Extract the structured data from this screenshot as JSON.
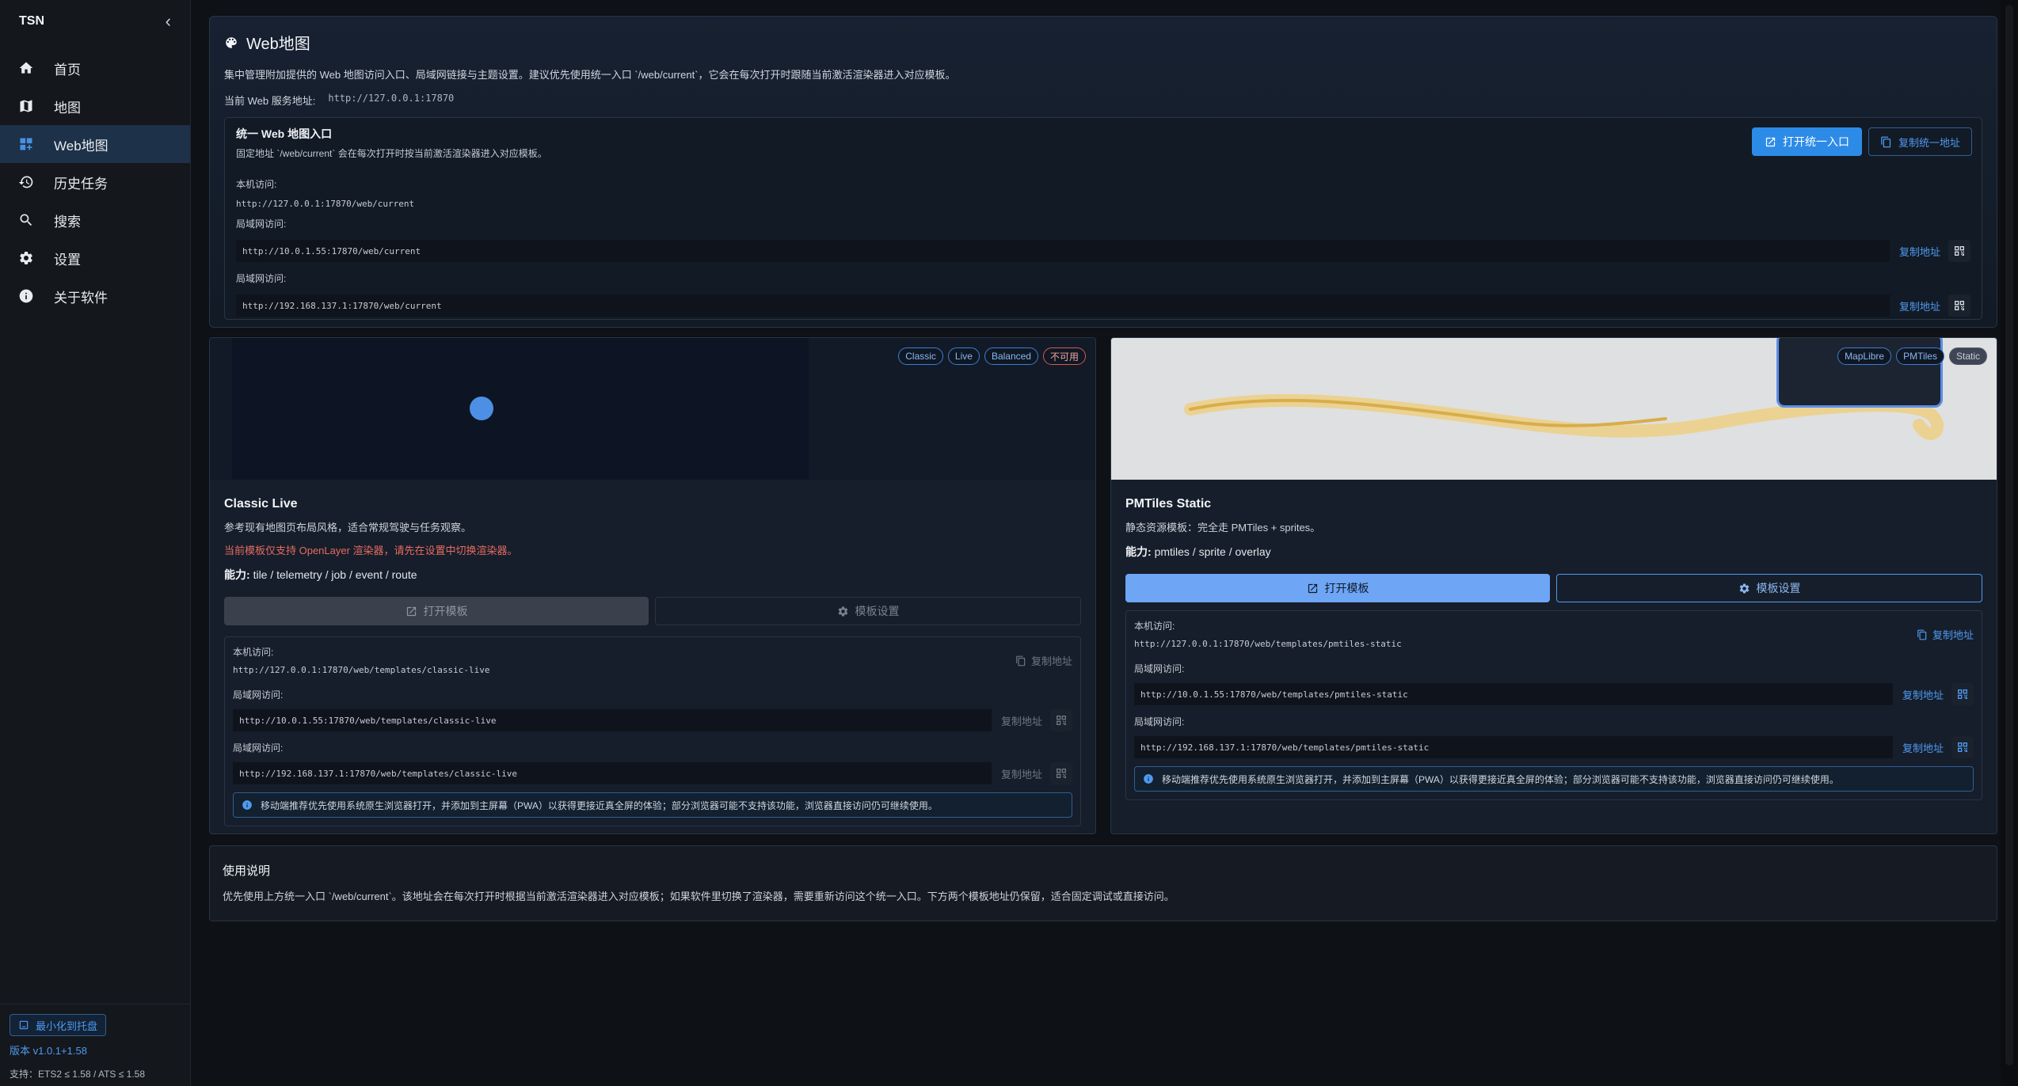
{
  "sidebar": {
    "brand": "TSN",
    "collapse_icon": "chevron-left-icon",
    "items": [
      {
        "label": "首页",
        "icon": "home-icon"
      },
      {
        "label": "地图",
        "icon": "map-icon"
      },
      {
        "label": "Web地图",
        "icon": "dashboard-icon",
        "active": true
      },
      {
        "label": "历史任务",
        "icon": "history-icon"
      },
      {
        "label": "搜索",
        "icon": "search-icon"
      },
      {
        "label": "设置",
        "icon": "gear-icon"
      },
      {
        "label": "关于软件",
        "icon": "info-icon"
      }
    ],
    "tray_button": "最小化到托盘",
    "version": "版本 v1.0.1+1.58",
    "support": "支持：ETS2 ≤ 1.58 / ATS ≤ 1.58"
  },
  "hero": {
    "title": "Web地图",
    "description": "集中管理附加提供的 Web 地图访问入口、局域网链接与主题设置。建议优先使用统一入口 `/web/current`，它会在每次打开时跟随当前激活渲染器进入对应模板。",
    "service_label": "当前 Web 服务地址:",
    "service_url": "http://127.0.0.1:17870",
    "entry": {
      "title": "统一 Web 地图入口",
      "subtitle": "固定地址 `/web/current` 会在每次打开时按当前激活渲染器进入对应模板。",
      "open_button": "打开统一入口",
      "copy_button": "复制统一地址",
      "local_label": "本机访问:",
      "local_url": "http://127.0.0.1:17870/web/current",
      "lan_label_1": "局域网访问:",
      "lan_url_1": "http://10.0.1.55:17870/web/current",
      "lan_label_2": "局域网访问:",
      "lan_url_2": "http://192.168.137.1:17870/web/current",
      "copy_link": "复制地址"
    }
  },
  "cards": [
    {
      "tags": [
        "Classic",
        "Live",
        "Balanced",
        "不可用"
      ],
      "title": "Classic Live",
      "description": "参考现有地图页布局风格，适合常规驾驶与任务观察。",
      "warning": "当前模板仅支持 OpenLayer 渲染器，请先在设置中切换渲染器。",
      "capability_label": "能力:",
      "capability": "tile / telemetry / job / event / route",
      "open_button": "打开模板",
      "settings_button": "模板设置",
      "local_label": "本机访问:",
      "local_url": "http://127.0.0.1:17870/web/templates/classic-live",
      "lan_label_1": "局域网访问:",
      "lan_url_1": "http://10.0.1.55:17870/web/templates/classic-live",
      "lan_label_2": "局域网访问:",
      "lan_url_2": "http://192.168.137.1:17870/web/templates/classic-live",
      "copy_link": "复制地址",
      "notice": "移动端推荐优先使用系统原生浏览器打开，并添加到主屏幕（PWA）以获得更接近真全屏的体验；部分浏览器可能不支持该功能，浏览器直接访问仍可继续使用。"
    },
    {
      "tags": [
        "MapLibre",
        "PMTiles",
        "Static"
      ],
      "title": "PMTiles Static",
      "description": "静态资源模板：完全走 PMTiles + sprites。",
      "capability_label": "能力:",
      "capability": "pmtiles / sprite / overlay",
      "open_button": "打开模板",
      "settings_button": "模板设置",
      "local_label": "本机访问:",
      "local_url": "http://127.0.0.1:17870/web/templates/pmtiles-static",
      "lan_label_1": "局域网访问:",
      "lan_url_1": "http://10.0.1.55:17870/web/templates/pmtiles-static",
      "lan_label_2": "局域网访问:",
      "lan_url_2": "http://192.168.137.1:17870/web/templates/pmtiles-static",
      "copy_link": "复制地址",
      "notice": "移动端推荐优先使用系统原生浏览器打开，并添加到主屏幕（PWA）以获得更接近真全屏的体验；部分浏览器可能不支持该功能，浏览器直接访问仍可继续使用。"
    }
  ],
  "usage": {
    "title": "使用说明",
    "text": "优先使用上方统一入口 `/web/current`。该地址会在每次打开时根据当前激活渲染器进入对应模板；如果软件里切换了渲染器，需要重新访问这个统一入口。下方两个模板地址仍保留，适合固定调试或直接访问。"
  },
  "colors": {
    "accent": "#2d8be8",
    "danger": "#e76b5f",
    "active_nav": "#1d3148"
  }
}
